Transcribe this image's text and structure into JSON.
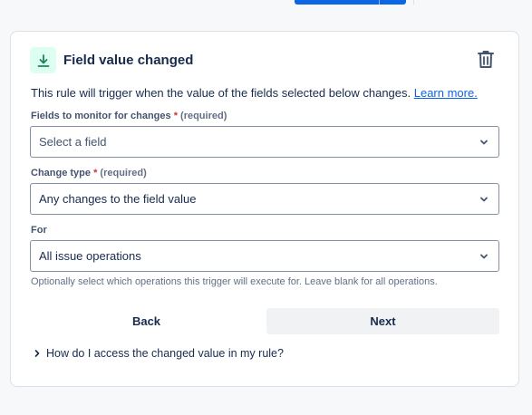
{
  "trigger": {
    "title": "Field value changed",
    "icon": "field-download-icon",
    "icon_bg": "#dcfff1",
    "icon_color": "#1f845a",
    "delete_icon": "trash-icon"
  },
  "description": {
    "text": "This rule will trigger when the value of the fields selected below changes. ",
    "link_label": "Learn more."
  },
  "fields_to_monitor": {
    "label": "Fields to monitor for changes",
    "required_marker": "*",
    "required_text": "(required)",
    "placeholder": "Select a field"
  },
  "change_type": {
    "label": "Change type",
    "required_marker": "*",
    "required_text": "(required)",
    "value": "Any changes to the field value"
  },
  "for_field": {
    "label": "For",
    "value": "All issue operations",
    "helper": "Optionally select which operations this trigger will execute for. Leave blank for all operations."
  },
  "buttons": {
    "back": "Back",
    "next": "Next"
  },
  "expander": {
    "label": "How do I access the changed value in my rule?"
  },
  "colors": {
    "primary": "#0c66e4",
    "required": "#c9372c",
    "text": "#172b4d"
  }
}
